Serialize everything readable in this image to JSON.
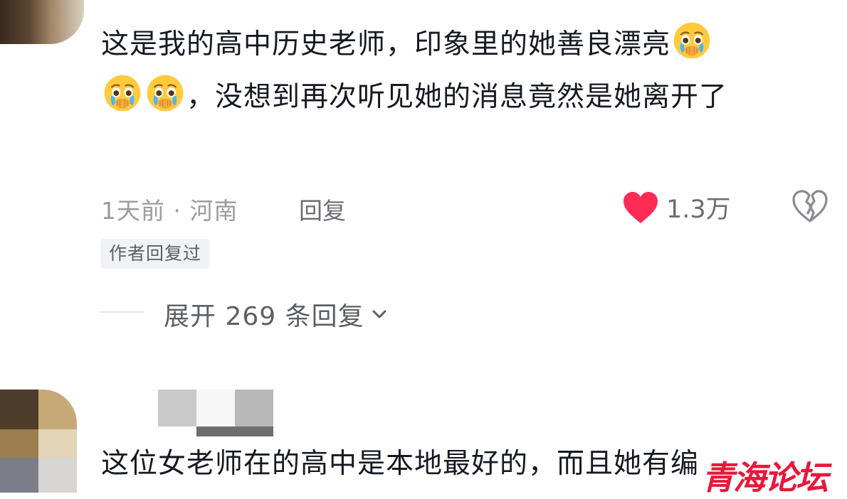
{
  "comment1": {
    "text_part1": "这是我的高中历史老师，印象里的她善良漂亮",
    "text_part2": "，没想到再次听见她的消息竟然是她离开了",
    "emoji_name": "crying-holding-back-tears-emoji",
    "time": "1天前",
    "separator": "·",
    "location": "河南",
    "reply_label": "回复",
    "like_count": "1.3万",
    "liked": true,
    "like_color": "#fe2c55",
    "author_badge": "作者回复过",
    "expand_label": "展开 269 条回复"
  },
  "comment2": {
    "text": "这位女老师在的高中是本地最好的，而且她有编"
  },
  "watermark": {
    "text": "青海论坛",
    "color": "#e8173a"
  },
  "icons": {
    "like": "heart-icon",
    "dislike": "broken-heart-icon",
    "expand": "chevron-down-icon"
  }
}
